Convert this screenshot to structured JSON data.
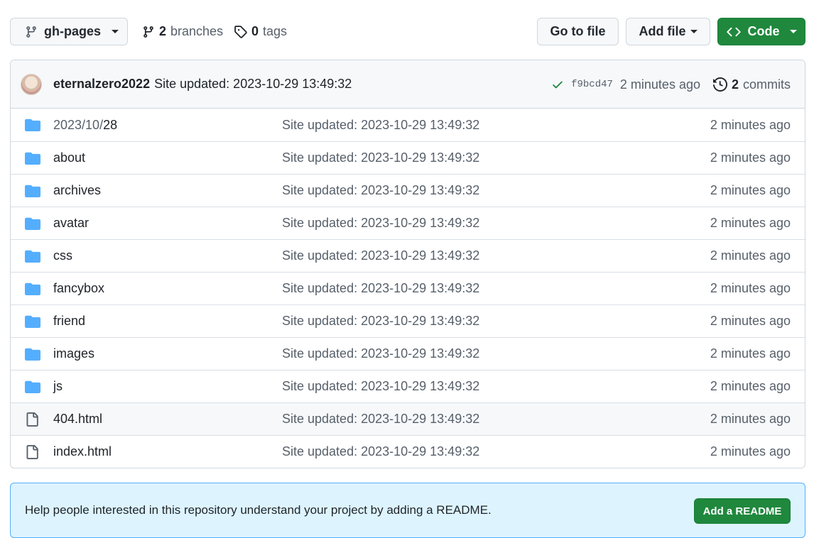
{
  "toolbar": {
    "branch": "gh-pages",
    "branches_count": "2",
    "branches_label": "branches",
    "tags_count": "0",
    "tags_label": "tags",
    "goto_file": "Go to file",
    "add_file": "Add file",
    "code": "Code"
  },
  "commit": {
    "author": "eternalzero2022",
    "message": "Site updated: 2023-10-29 13:49:32",
    "sha": "f9bcd47",
    "time": "2 minutes ago",
    "commits_count": "2",
    "commits_label": "commits"
  },
  "files": [
    {
      "type": "folder",
      "name_prefix": "2023/10/",
      "name": "28",
      "message": "Site updated: 2023-10-29 13:49:32",
      "age": "2 minutes ago"
    },
    {
      "type": "folder",
      "name_prefix": "",
      "name": "about",
      "message": "Site updated: 2023-10-29 13:49:32",
      "age": "2 minutes ago"
    },
    {
      "type": "folder",
      "name_prefix": "",
      "name": "archives",
      "message": "Site updated: 2023-10-29 13:49:32",
      "age": "2 minutes ago"
    },
    {
      "type": "folder",
      "name_prefix": "",
      "name": "avatar",
      "message": "Site updated: 2023-10-29 13:49:32",
      "age": "2 minutes ago"
    },
    {
      "type": "folder",
      "name_prefix": "",
      "name": "css",
      "message": "Site updated: 2023-10-29 13:49:32",
      "age": "2 minutes ago"
    },
    {
      "type": "folder",
      "name_prefix": "",
      "name": "fancybox",
      "message": "Site updated: 2023-10-29 13:49:32",
      "age": "2 minutes ago"
    },
    {
      "type": "folder",
      "name_prefix": "",
      "name": "friend",
      "message": "Site updated: 2023-10-29 13:49:32",
      "age": "2 minutes ago"
    },
    {
      "type": "folder",
      "name_prefix": "",
      "name": "images",
      "message": "Site updated: 2023-10-29 13:49:32",
      "age": "2 minutes ago"
    },
    {
      "type": "folder",
      "name_prefix": "",
      "name": "js",
      "message": "Site updated: 2023-10-29 13:49:32",
      "age": "2 minutes ago"
    },
    {
      "type": "file",
      "name_prefix": "",
      "name": "404.html",
      "message": "Site updated: 2023-10-29 13:49:32",
      "age": "2 minutes ago"
    },
    {
      "type": "file",
      "name_prefix": "",
      "name": "index.html",
      "message": "Site updated: 2023-10-29 13:49:32",
      "age": "2 minutes ago"
    }
  ],
  "readme": {
    "text": "Help people interested in this repository understand your project by adding a README.",
    "button": "Add a README"
  },
  "colors": {
    "folder_icon": "#54aeff",
    "file_icon": "#57606a",
    "primary_button": "#1f883d",
    "banner_bg": "#ddf4ff"
  }
}
